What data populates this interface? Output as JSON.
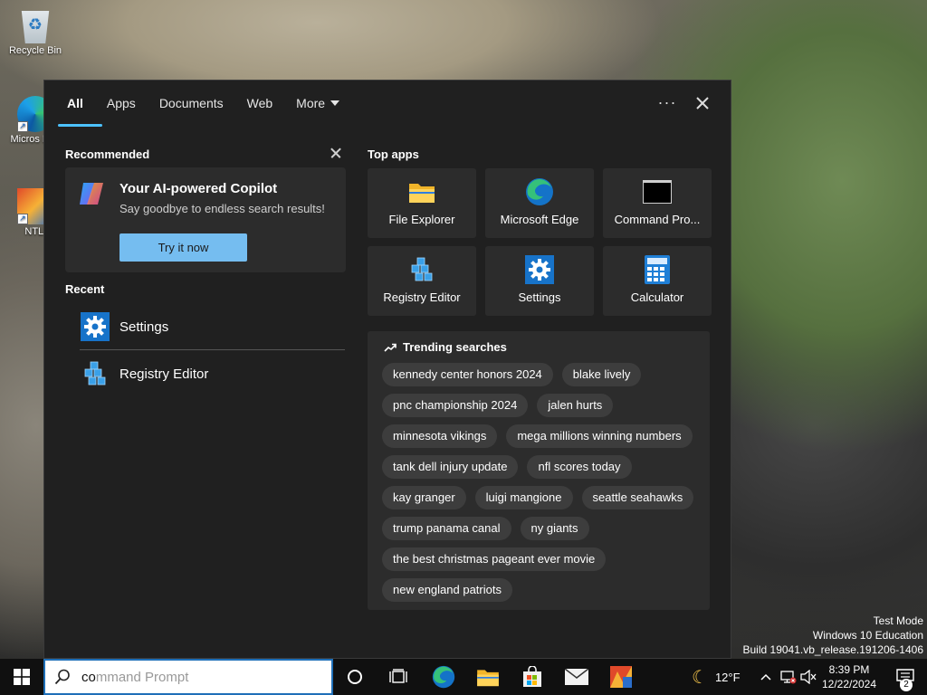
{
  "desktop": {
    "icons": [
      {
        "label": "Recycle Bin"
      },
      {
        "label": "Micros Edg"
      },
      {
        "label": "NTLi"
      }
    ]
  },
  "search_panel": {
    "tabs": [
      {
        "label": "All",
        "active": true
      },
      {
        "label": "Apps"
      },
      {
        "label": "Documents"
      },
      {
        "label": "Web"
      },
      {
        "label": "More"
      }
    ],
    "more_options": "···",
    "recommended": {
      "title": "Recommended",
      "copilot_title": "Your AI-powered Copilot",
      "copilot_subtitle": "Say goodbye to endless search results!",
      "try_button": "Try it now"
    },
    "recent": {
      "title": "Recent",
      "items": [
        {
          "label": "Settings",
          "icon": "gear-icon"
        },
        {
          "label": "Registry Editor",
          "icon": "registry-editor-icon"
        }
      ]
    },
    "top_apps": {
      "title": "Top apps",
      "items": [
        {
          "label": "File Explorer",
          "icon": "folder-icon"
        },
        {
          "label": "Microsoft Edge",
          "icon": "edge-icon"
        },
        {
          "label": "Command Pro...",
          "icon": "command-prompt-icon"
        },
        {
          "label": "Registry Editor",
          "icon": "registry-editor-icon"
        },
        {
          "label": "Settings",
          "icon": "gear-icon"
        },
        {
          "label": "Calculator",
          "icon": "calculator-icon"
        }
      ]
    },
    "trending": {
      "title": "Trending searches",
      "items": [
        "kennedy center honors 2024",
        "blake lively",
        "pnc championship 2024",
        "jalen hurts",
        "minnesota vikings",
        "mega millions winning numbers",
        "tank dell injury update",
        "nfl scores today",
        "kay granger",
        "luigi mangione",
        "seattle seahawks",
        "trump panama canal",
        "ny giants",
        "the best christmas pageant ever movie",
        "new england patriots"
      ]
    }
  },
  "watermark": {
    "line1": "Test Mode",
    "line2": "Windows 10 Education",
    "line3": "Build 19041.vb_release.191206-1406"
  },
  "taskbar": {
    "search_typed": "co",
    "search_suggestion_rest": "mmand Prompt",
    "weather": "12°F",
    "time": "8:39 PM",
    "date": "12/22/2024",
    "notification_count": "2"
  },
  "colors": {
    "panel_bg": "#202020",
    "tile_bg": "#2c2c2c",
    "accent": "#4cc2ff",
    "copilot_button": "#75bdf0"
  }
}
